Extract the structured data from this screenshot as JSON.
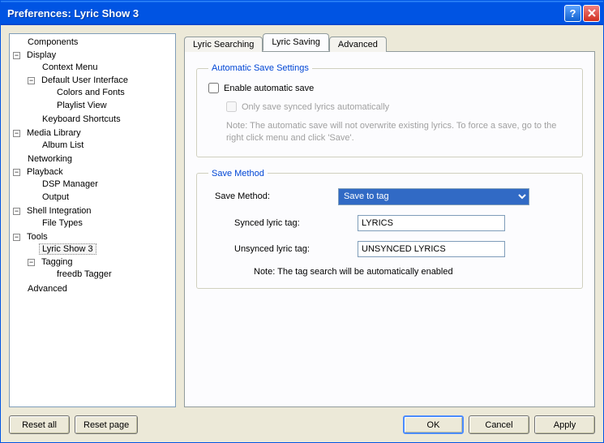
{
  "window": {
    "title": "Preferences: Lyric Show 3"
  },
  "tree": {
    "components": "Components",
    "display": "Display",
    "context_menu": "Context Menu",
    "default_ui": "Default User Interface",
    "colors_fonts": "Colors and Fonts",
    "playlist_view": "Playlist View",
    "kbd_shortcuts": "Keyboard Shortcuts",
    "media_library": "Media Library",
    "album_list": "Album List",
    "networking": "Networking",
    "playback": "Playback",
    "dsp_manager": "DSP Manager",
    "output": "Output",
    "shell_integration": "Shell Integration",
    "file_types": "File Types",
    "tools": "Tools",
    "lyric_show_3": "Lyric Show 3",
    "tagging": "Tagging",
    "freedb_tagger": "freedb Tagger",
    "advanced": "Advanced"
  },
  "tabs": {
    "lyric_searching": "Lyric Searching",
    "lyric_saving": "Lyric Saving",
    "advanced": "Advanced"
  },
  "auto_save": {
    "legend": "Automatic Save Settings",
    "enable": "Enable automatic save",
    "only_synced": "Only save synced lyrics automatically",
    "note": "Note: The automatic save will not overwrite existing lyrics. To force a save, go to the right click menu and click 'Save'."
  },
  "save_method": {
    "legend": "Save Method",
    "label": "Save Method:",
    "value": "Save to tag",
    "synced_label": "Synced lyric tag:",
    "synced_value": "LYRICS",
    "unsynced_label": "Unsynced lyric tag:",
    "unsynced_value": "UNSYNCED LYRICS",
    "note": "Note: The tag search will be automatically enabled"
  },
  "buttons": {
    "reset_all": "Reset all",
    "reset_page": "Reset page",
    "ok": "OK",
    "cancel": "Cancel",
    "apply": "Apply"
  }
}
